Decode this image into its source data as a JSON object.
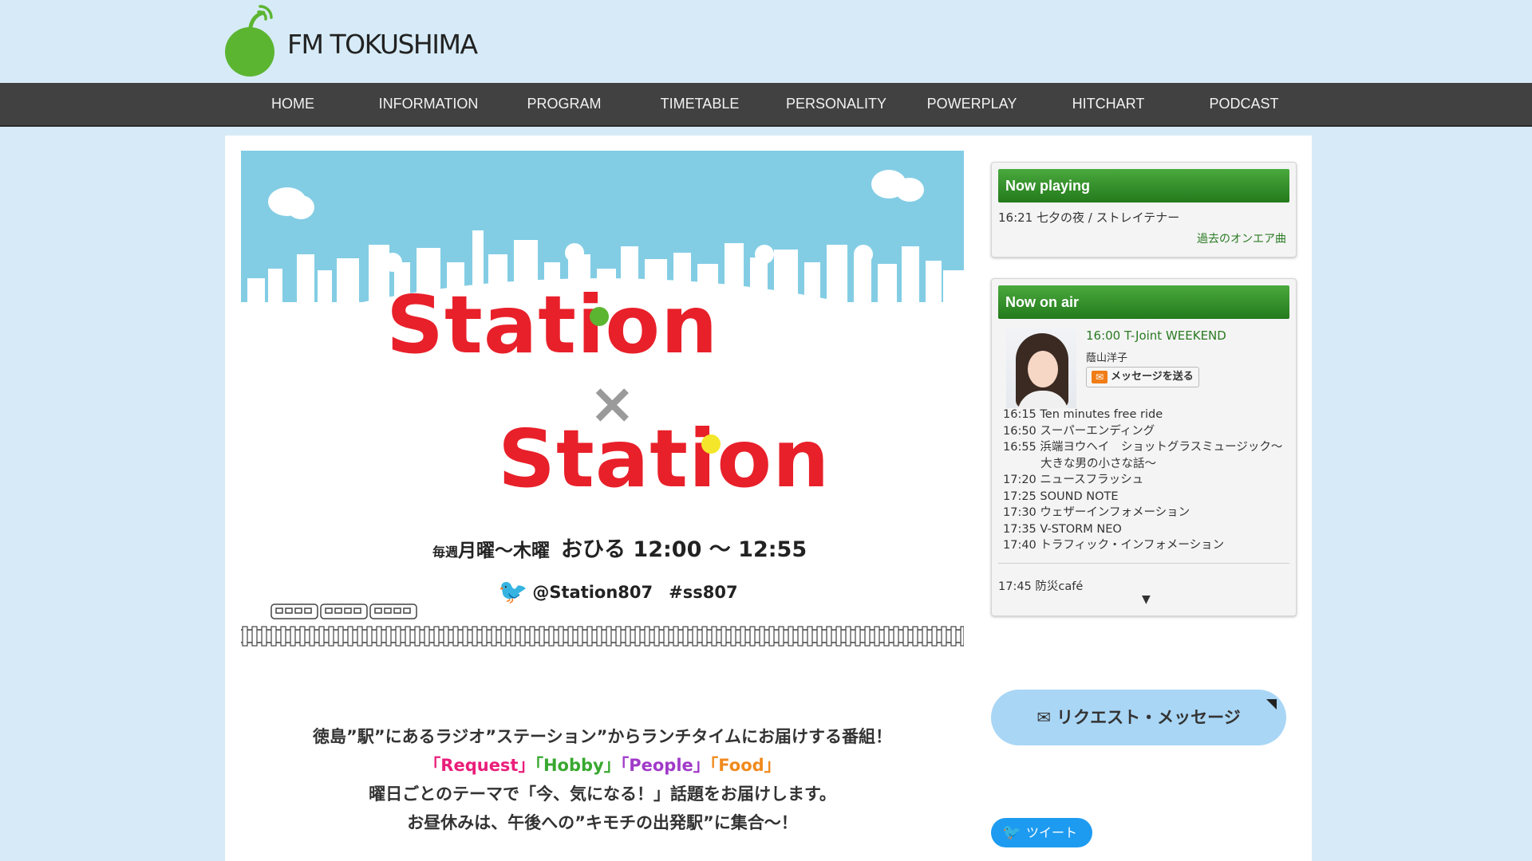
{
  "site": {
    "logo_text": "FM TOKUSHIMA"
  },
  "nav": {
    "items": [
      {
        "label": "HOME"
      },
      {
        "label": "INFORMATION"
      },
      {
        "label": "PROGRAM"
      },
      {
        "label": "TIMETABLE"
      },
      {
        "label": "PERSONALITY"
      },
      {
        "label": "POWERPLAY"
      },
      {
        "label": "HITCHART"
      },
      {
        "label": "PODCAST"
      }
    ]
  },
  "hero": {
    "title_line1": "Station",
    "title_cross": "×",
    "title_line2": "Station",
    "schedule_prefix": "毎週",
    "schedule_days": "月曜～木曜",
    "schedule_time": "おひる 12:00 ～ 12:55",
    "twitter_handle": "@Station807",
    "hashtag": "#ss807"
  },
  "description": {
    "line1": "徳島”駅”にあるラジオ”ステーション”からランチタイムにお届けする番組！",
    "tag_request": "「Request」",
    "tag_hobby": "「Hobby」",
    "tag_people": "「People」",
    "tag_food": "「Food」",
    "line3": "曜日ごとのテーマで「今、気になる！」話題をお届けします。",
    "line4": "お昼休みは、午後への”キモチの出発駅”に集合～！"
  },
  "now_playing": {
    "header": "Now playing",
    "track": "16:21 七夕の夜 / ストレイテナー",
    "past_link": "過去のオンエア曲"
  },
  "now_on_air": {
    "header": "Now on air",
    "program": "16:00 T-Joint WEEKEND",
    "host": "蔭山洋子",
    "message_button": "メッセージを送る",
    "schedule": [
      {
        "text": "16:15 Ten minutes free ride"
      },
      {
        "text": "16:50 スーパーエンディング"
      },
      {
        "text": "16:55 浜端ヨウヘイ　ショットグラスミュージック～"
      },
      {
        "text": "大きな男の小さな話～",
        "indent": true
      },
      {
        "text": "17:20 ニュースフラッシュ"
      },
      {
        "text": "17:25 SOUND NOTE"
      },
      {
        "text": "17:30 ウェザーインフォメーション"
      },
      {
        "text": "17:35 V-STORM NEO"
      },
      {
        "text": "17:40 トラフィック・インフォメーション"
      }
    ],
    "next": "17:45 防災café",
    "more_arrow": "▼"
  },
  "request_button": {
    "icon": "mail-icon",
    "label": "リクエスト・メッセージ"
  },
  "tweet_button": {
    "icon": "twitter-bird-icon",
    "label": "ツイート"
  },
  "colors": {
    "background": "#d6ebf7",
    "nav": "#414141",
    "accent_green": "#2f8c25",
    "hero_red": "#e8202a",
    "sky": "#83cde4",
    "twitter_blue": "#1d9bf0"
  }
}
